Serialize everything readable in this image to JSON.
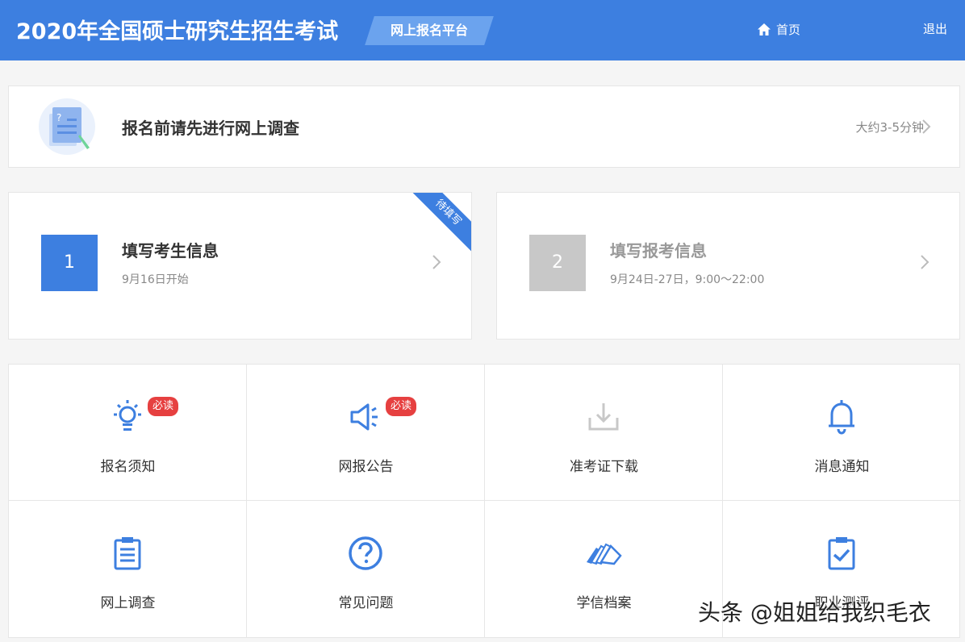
{
  "header": {
    "title": "2020年全国硕士研究生招生考试",
    "platform": "网上报名平台",
    "home_label": "首页",
    "logout_label": "退出"
  },
  "survey": {
    "label": "报名前请先进行网上调查",
    "time": "大约3-5分钟"
  },
  "steps": [
    {
      "num": "1",
      "title": "填写考生信息",
      "desc": "9月16日开始",
      "ribbon": "待填写"
    },
    {
      "num": "2",
      "title": "填写报考信息",
      "desc": "9月24日-27日，9:00～22:00"
    }
  ],
  "grid": [
    {
      "label": "报名须知",
      "icon": "lightbulb-icon",
      "badge": "必读"
    },
    {
      "label": "网报公告",
      "icon": "megaphone-icon",
      "badge": "必读"
    },
    {
      "label": "准考证下载",
      "icon": "download-icon"
    },
    {
      "label": "消息通知",
      "icon": "bell-icon"
    },
    {
      "label": "网上调查",
      "icon": "clipboard-list-icon"
    },
    {
      "label": "常见问题",
      "icon": "question-circle-icon"
    },
    {
      "label": "学信档案",
      "icon": "documents-icon"
    },
    {
      "label": "职业测评",
      "icon": "clipboard-check-icon"
    }
  ],
  "watermark": "头条 @姐姐给我织毛衣",
  "colors": {
    "primary": "#3d7fe0",
    "badge": "#e64040",
    "disabled": "#c8c8c8"
  }
}
